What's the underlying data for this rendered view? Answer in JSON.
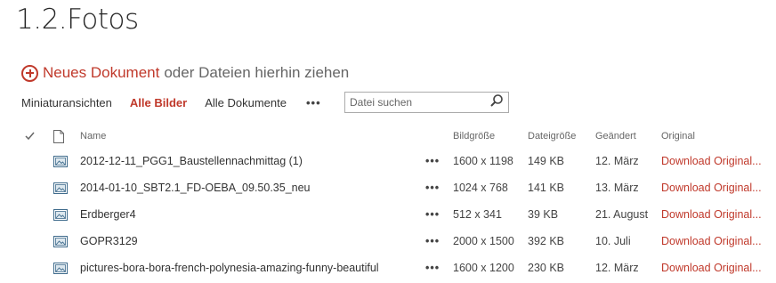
{
  "page": {
    "title": "1.2.Fotos"
  },
  "new_document": {
    "icon": "add-circle-icon",
    "link_label": "Neues Dokument",
    "suffix": "oder Dateien hierhin ziehen"
  },
  "views": {
    "tabs": [
      {
        "label": "Miniaturansichten",
        "active": false
      },
      {
        "label": "Alle Bilder",
        "active": true
      },
      {
        "label": "Alle Dokumente",
        "active": false
      }
    ],
    "more_label": "•••"
  },
  "search": {
    "placeholder": "Datei suchen",
    "value": ""
  },
  "table": {
    "columns": {
      "check": "✓",
      "name": "Name",
      "dimensions": "Bildgröße",
      "size": "Dateigröße",
      "modified": "Geändert",
      "original": "Original"
    },
    "row_menu_label": "•••",
    "rows": [
      {
        "name": "2012-12-11_PGG1_Baustellennachmittag (1)",
        "dimensions": "1600 x 1198",
        "size": "149 KB",
        "modified": "12. März",
        "original": "Download Original..."
      },
      {
        "name": "2014-01-10_SBT2.1_FD-OEBA_09.50.35_neu",
        "dimensions": "1024 x 768",
        "size": "141 KB",
        "modified": "13. März",
        "original": "Download Original..."
      },
      {
        "name": "Erdberger4",
        "dimensions": "512 x 341",
        "size": "39 KB",
        "modified": "21. August",
        "original": "Download Original..."
      },
      {
        "name": "GOPR3129",
        "dimensions": "2000 x 1500",
        "size": "392 KB",
        "modified": "10. Juli",
        "original": "Download Original..."
      },
      {
        "name": "pictures-bora-bora-french-polynesia-amazing-funny-beautiful",
        "dimensions": "1600 x 1200",
        "size": "230 KB",
        "modified": "12. März",
        "original": "Download Original..."
      }
    ]
  },
  "colors": {
    "accent": "#c0392b",
    "text": "#444444",
    "title": "#262626"
  }
}
